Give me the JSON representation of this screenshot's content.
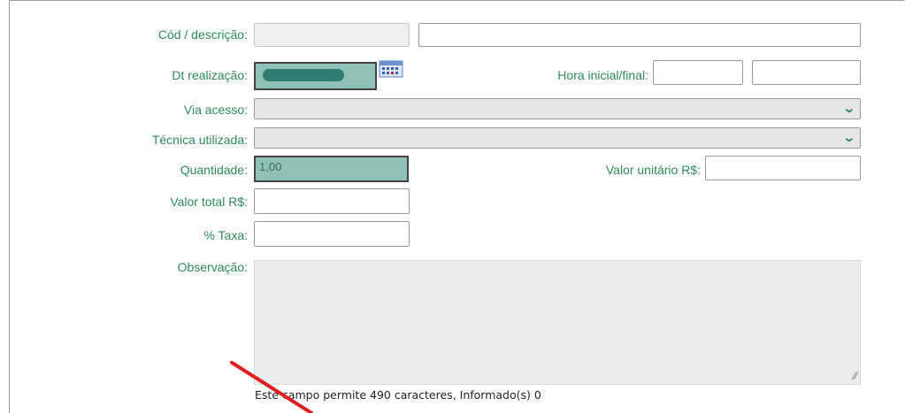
{
  "form": {
    "cod_label": "Cód / descrição:",
    "dt_label": "Dt realização:",
    "hora_label": "Hora inicial/final:",
    "via_label": "Via acesso:",
    "tecnica_label": "Técnica utilizada:",
    "quantidade_label": "Quantidade:",
    "quantidade_value": "1,00",
    "valor_unitario_label": "Valor unitário R$:",
    "valor_total_label": "Valor total R$:",
    "taxa_label": "% Taxa:",
    "observacao_label": "Observação:",
    "counter_text": "Este campo permite 490 caracteres, Informado(s) 0"
  },
  "icons": {
    "calendar": "calendar-icon",
    "dropdown": "chevron-down-icon"
  },
  "colors": {
    "label": "#2e8b57",
    "highlight": "#8fc1b6",
    "pill": "#2f7d73",
    "arrow": "#e02020"
  }
}
